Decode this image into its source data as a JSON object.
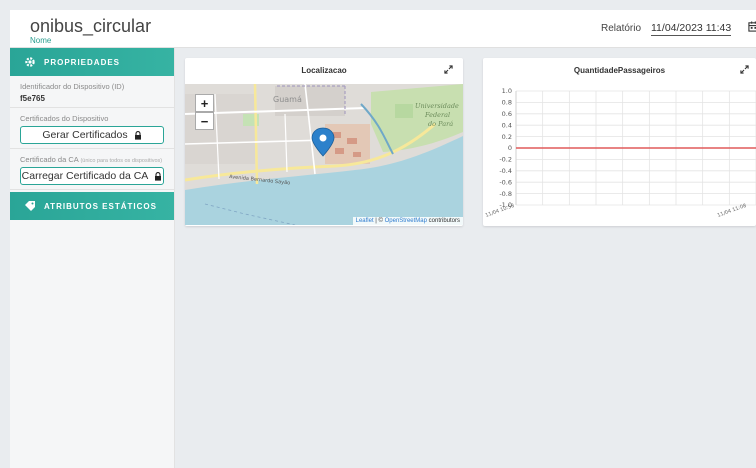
{
  "header": {
    "title": "onibus_circular",
    "subtitle": "Nome",
    "report_label": "Relatório",
    "date_value": "11/04/2023 11:43"
  },
  "sidebar": {
    "properties_title": "PROPRIEDADES",
    "device_id_label": "Identificador do Dispositivo (ID)",
    "device_id_value": "f5e765",
    "certs_label": "Certificados do Dispositivo",
    "gen_certs_button": "Gerar Certificados",
    "ca_cert_label": "Certificado da CA",
    "ca_cert_note": "(único para todos os dispositivos)",
    "upload_ca_button": "Carregar Certificado da CA",
    "static_attrs_title": "ATRIBUTOS ESTÁTICOS"
  },
  "map_card": {
    "title": "Localizacao",
    "zoom_in": "+",
    "zoom_out": "−",
    "labels": {
      "district": "Guamá",
      "university_1": "Universidade",
      "university_2": "Federal",
      "university_3": "do Pará",
      "avenue": "Avenida Bernardo Sayão"
    },
    "attribution_leaflet": "Leaflet",
    "attribution_sep": " | © ",
    "attribution_osm": "OpenStreetMap",
    "attribution_suffix": " contributors"
  },
  "chart_card": {
    "title": "QuantidadePassageiros"
  },
  "chart_data": {
    "type": "line",
    "title": "QuantidadePassageiros",
    "xlabel": "",
    "ylabel": "",
    "ylim": [
      -1.0,
      1.0
    ],
    "yticks": [
      "1.0",
      "0.8",
      "0.6",
      "0.4",
      "0.2",
      "0",
      "-0.2",
      "-0.4",
      "-0.6",
      "-0.8",
      "-1.0"
    ],
    "xticks": [
      "11/04 10:58",
      "11/04 11:08"
    ],
    "series": [
      {
        "color": "#e05a5a",
        "x": [
          "11/04 10:58",
          "11/04 11:08"
        ],
        "values": [
          0,
          0
        ]
      }
    ],
    "grid": true
  },
  "colors": {
    "accent": "#2aa597",
    "series_line": "#e05a5a",
    "map_water": "#aad3df"
  }
}
